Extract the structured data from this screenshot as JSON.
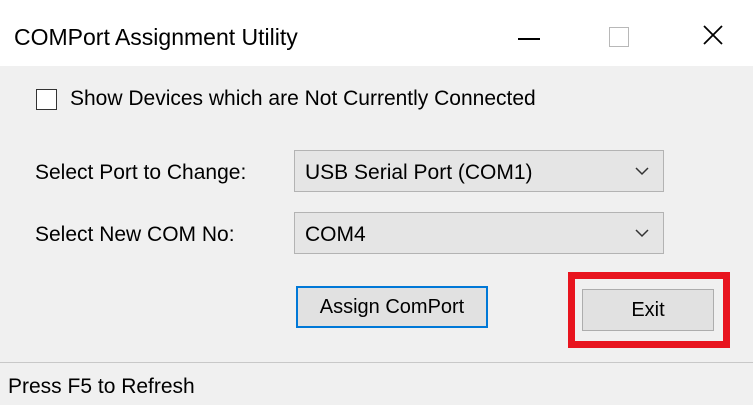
{
  "window": {
    "title": "COMPort Assignment Utility"
  },
  "options": {
    "show_disconnected_label": "Show Devices which are Not Currently Connected",
    "show_disconnected_checked": false
  },
  "form": {
    "port_label": "Select Port to Change:",
    "port_value": "USB Serial Port (COM1)",
    "com_label": "Select New COM No:",
    "com_value": "COM4"
  },
  "buttons": {
    "assign_label": "Assign ComPort",
    "exit_label": "Exit"
  },
  "status": {
    "text": "Press F5 to Refresh"
  },
  "icons": {
    "minimize": "minimize-icon",
    "maximize": "maximize-icon",
    "close": "close-icon",
    "dropdown": "chevron-down-icon"
  },
  "colors": {
    "focus_border": "#0078d7",
    "highlight": "#e8141e"
  }
}
